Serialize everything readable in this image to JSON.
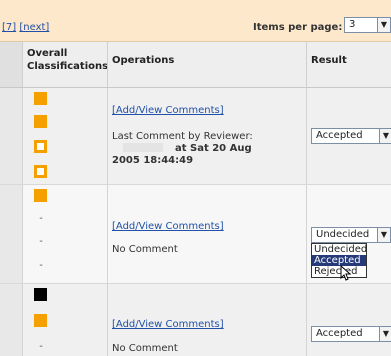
{
  "pager": {
    "pages": [
      {
        "label": "[7]"
      },
      {
        "label": "[next]"
      }
    ]
  },
  "items_per_page": {
    "label": "Items per page:",
    "value": "3"
  },
  "headers": {
    "overall": "Overall",
    "classifications": "Classifications",
    "operations": "Operations",
    "result": "Result"
  },
  "rows": [
    {
      "link": "[Add/View Comments]",
      "comment_line1": "Last Comment by Reviewer:",
      "comment_line2_suffix": "at Sat 20 Aug",
      "comment_line3": "2005 18:44:49",
      "result": "Accepted"
    },
    {
      "link": "[Add/View Comments]",
      "comment_line1": "No Comment",
      "result": "Undecided",
      "options": [
        "Undecided",
        "Accepted",
        "Rejected"
      ]
    },
    {
      "link": "[Add/View Comments]",
      "comment_line1": "No Comment",
      "result": "Accepted"
    }
  ],
  "colors": {
    "orange": "#f6a000",
    "header_bg": "#fde8cc",
    "link": "#2050a8",
    "highlight": "#263a7a"
  }
}
